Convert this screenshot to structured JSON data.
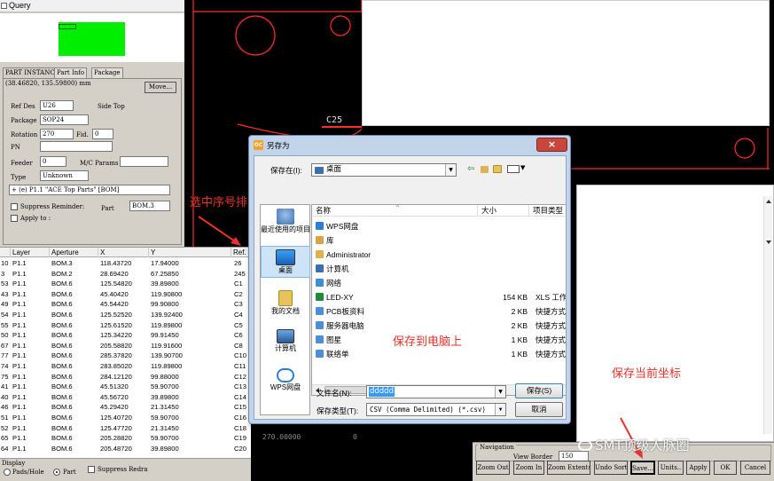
{
  "query": {
    "title": "Query",
    "tabs": [
      "PART INSTANCE",
      "Part Info",
      "Package"
    ],
    "coords": "(38.46820, 135.59800) mm",
    "move_label": "Move...",
    "ref_des_label": "Ref Des",
    "ref_des_value": "U26",
    "side_label": "Side Top",
    "package_label": "Package",
    "package_value": "SOP24",
    "rotation_label": "Rotation",
    "rotation_value": "270",
    "fid_label": "Fid.",
    "fid_value": "0",
    "pn_label": "PN",
    "pn_value": "",
    "feeder_label": "Feeder",
    "feeder_value": "0",
    "mc_label": "M/C Params",
    "mc_value": "",
    "type_label": "Type",
    "type_value": "Unknown",
    "bom_line": "+ (e) P1.1 \"ACE Top Parts\" [BOM]",
    "suppress_label": "Suppress Reminder:",
    "part_label": "Part",
    "part_value": "BOM.3",
    "apply_label": "Apply to :"
  },
  "table": {
    "headers": [
      "Layer",
      "Aperture",
      "X",
      "Y",
      "Ref."
    ],
    "rows": [
      [
        "10",
        "P1.1",
        "BOM.3",
        "118.43720",
        "17.94000",
        "26"
      ],
      [
        "3",
        "P1.1",
        "BOM.2",
        "28.69420",
        "67.25850",
        "245"
      ],
      [
        "53",
        "P1.1",
        "BOM.6",
        "125.54820",
        "39.89800",
        "C1"
      ],
      [
        "43",
        "P1.1",
        "BOM.6",
        "45.40420",
        "119.90800",
        "C2"
      ],
      [
        "49",
        "P1.1",
        "BOM.6",
        "45.54420",
        "99.90800",
        "C3"
      ],
      [
        "54",
        "P1.1",
        "BOM.6",
        "125.52520",
        "139.92400",
        "C4"
      ],
      [
        "55",
        "P1.1",
        "BOM.6",
        "125.61520",
        "119.89800",
        "C5"
      ],
      [
        "50",
        "P1.1",
        "BOM.6",
        "125.34220",
        "99.91450",
        "C6"
      ],
      [
        "67",
        "P1.1",
        "BOM.6",
        "205.58820",
        "119.91600",
        "C8"
      ],
      [
        "77",
        "P1.1",
        "BOM.6",
        "285.37820",
        "139.90700",
        "C10"
      ],
      [
        "74",
        "P1.1",
        "BOM.6",
        "283.85020",
        "119.89800",
        "C11"
      ],
      [
        "75",
        "P1.1",
        "BOM.6",
        "284.12120",
        "99.88000",
        "C12"
      ],
      [
        "41",
        "P1.1",
        "BOM.6",
        "45.51320",
        "59.90700",
        "C13"
      ],
      [
        "40",
        "P1.1",
        "BOM.6",
        "45.56720",
        "39.89800",
        "C14"
      ],
      [
        "46",
        "P1.1",
        "BOM.6",
        "45.29420",
        "21.31450",
        "C15"
      ],
      [
        "51",
        "P1.1",
        "BOM.6",
        "125.40720",
        "59.90700",
        "C16"
      ],
      [
        "52",
        "P1.1",
        "BOM.6",
        "125.47720",
        "21.31450",
        "C18"
      ],
      [
        "65",
        "P1.1",
        "BOM.6",
        "205.28820",
        "59.90700",
        "C19"
      ],
      [
        "64",
        "P1.1",
        "BOM.6",
        "205.48720",
        "39.89800",
        "C20"
      ]
    ],
    "display_label": "Display",
    "pads_label": "Pads/Hole",
    "part_label": "Part",
    "suppress_label": "Suppress Redra"
  },
  "cad": {
    "label_c25": "C25",
    "row_x": "270.00000",
    "row_y": "0"
  },
  "dialog": {
    "title": "另存为",
    "save_in_label": "保存在(I):",
    "save_in_value": "桌面",
    "places": [
      "最近使用的项目",
      "桌面",
      "我的文档",
      "计算机",
      "WPS网盘"
    ],
    "col_name": "名称",
    "col_size": "大小",
    "col_type": "项目类型",
    "files": [
      {
        "name": "WPS网盘",
        "size": "",
        "type": "",
        "icon": "cloud-icon"
      },
      {
        "name": "库",
        "size": "",
        "type": "",
        "icon": "library-icon"
      },
      {
        "name": "Administrator",
        "size": "",
        "type": "",
        "icon": "user-folder-icon"
      },
      {
        "name": "计算机",
        "size": "",
        "type": "",
        "icon": "computer-icon"
      },
      {
        "name": "网络",
        "size": "",
        "type": "",
        "icon": "network-icon"
      },
      {
        "name": "LED-XY",
        "size": "154 KB",
        "type": "XLS 工作表",
        "icon": "excel-file-icon"
      },
      {
        "name": "PCB板资料",
        "size": "2 KB",
        "type": "快捷方式",
        "icon": "shortcut-icon"
      },
      {
        "name": "服务器电脑",
        "size": "2 KB",
        "type": "快捷方式",
        "icon": "shortcut-icon"
      },
      {
        "name": "图星",
        "size": "1 KB",
        "type": "快捷方式",
        "icon": "shortcut-icon"
      },
      {
        "name": "联络单",
        "size": "1 KB",
        "type": "快捷方式",
        "icon": "shortcut-icon"
      }
    ],
    "filename_label": "文件名(N):",
    "filename_value": "ddddd",
    "filetype_label": "保存类型(T):",
    "filetype_value": "CSV (Comma Delimited) (*.csv)",
    "save_button": "保存(S)",
    "cancel_button": "取消"
  },
  "annotations": {
    "select_sort": "选中序号排",
    "save_to_pc": "保存到电脑上",
    "save_coords": "保存当前坐标"
  },
  "navigation": {
    "title": "Navigation",
    "view_border_label": "View Border",
    "view_border_value": "150",
    "buttons": [
      "Zoom Out",
      "Zoom In",
      "Zoom Extents",
      "Undo Sort",
      "Save...",
      "Units..",
      "Apply",
      "OK",
      "Cancel"
    ]
  },
  "watermark": "SMT顶级人脉圈",
  "colors": {
    "preview": "#00ee00",
    "annotation": "#e8322a",
    "cad_bg": "#000000",
    "cad_line": "#ff3030"
  }
}
